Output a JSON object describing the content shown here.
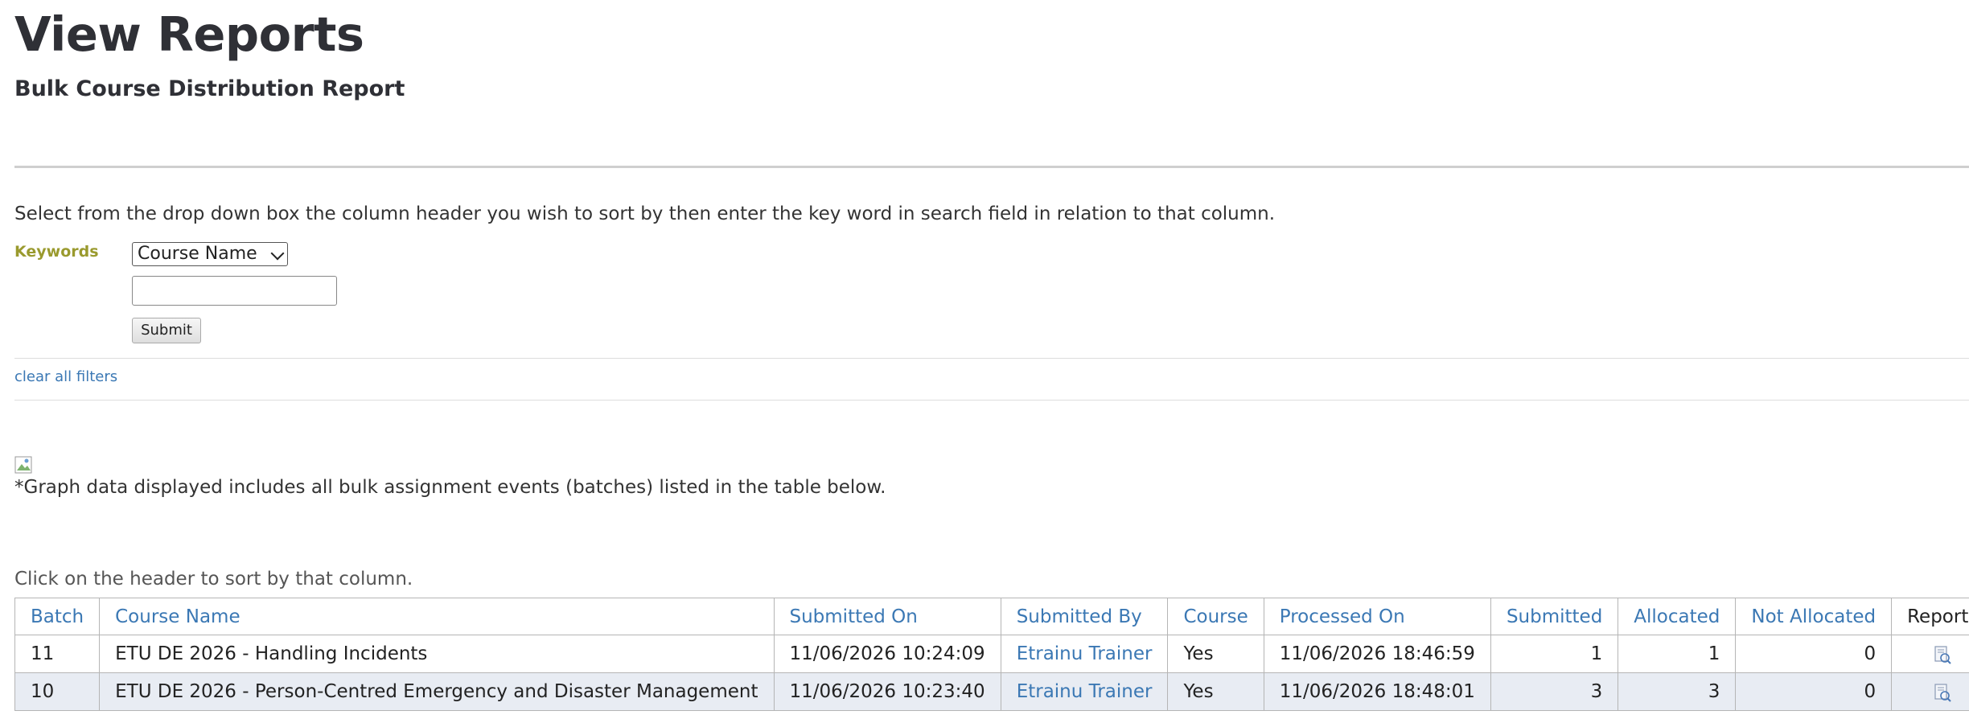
{
  "page": {
    "title": "View Reports",
    "subtitle": "Bulk Course Distribution Report"
  },
  "filter": {
    "instructions": "Select from the drop down box the column header you wish to sort by then enter the key word in search field in relation to that column.",
    "keywords_label": "Keywords",
    "selected_column": "Course Name",
    "search_value": "",
    "submit_label": "Submit",
    "clear_label": "clear all filters"
  },
  "graph": {
    "note": "*Graph data displayed includes all bulk assignment events (batches) listed in the table below."
  },
  "table": {
    "sort_note": "Click on the header to sort by that column.",
    "headers": {
      "batch": "Batch",
      "course_name": "Course Name",
      "submitted_on": "Submitted On",
      "submitted_by": "Submitted By",
      "course": "Course",
      "processed_on": "Processed On",
      "submitted": "Submitted",
      "allocated": "Allocated",
      "not_allocated": "Not Allocated",
      "reports": "Reports"
    },
    "rows": [
      {
        "batch": "11",
        "course_name": "ETU DE 2026 - Handling Incidents",
        "submitted_on": "11/06/2026 10:24:09",
        "submitted_by": "Etrainu Trainer",
        "course": "Yes",
        "processed_on": "11/06/2026 18:46:59",
        "submitted": "1",
        "allocated": "1",
        "not_allocated": "0"
      },
      {
        "batch": "10",
        "course_name": "ETU DE 2026 - Person-Centred Emergency and Disaster Management",
        "submitted_on": "11/06/2026 10:23:40",
        "submitted_by": "Etrainu Trainer",
        "course": "Yes",
        "processed_on": "11/06/2026 18:48:01",
        "submitted": "3",
        "allocated": "3",
        "not_allocated": "0"
      }
    ]
  },
  "colors": {
    "link": "#3b78b4",
    "keywords_label": "#9a9a2e",
    "alt_row": "#e8ecf3"
  }
}
